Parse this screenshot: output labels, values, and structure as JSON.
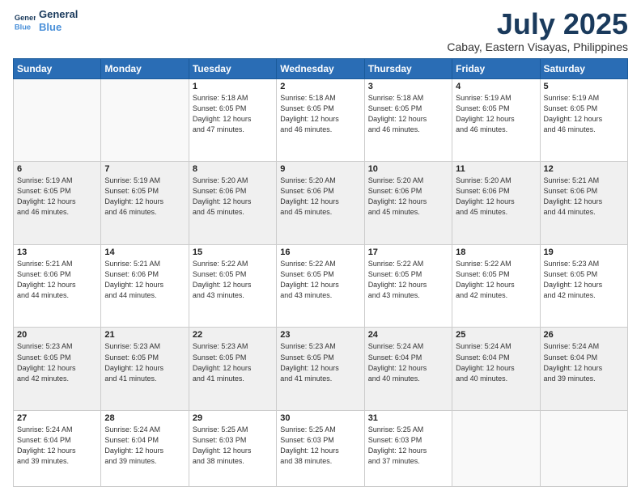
{
  "header": {
    "logo_line1": "General",
    "logo_line2": "Blue",
    "title": "July 2025",
    "subtitle": "Cabay, Eastern Visayas, Philippines"
  },
  "days_of_week": [
    "Sunday",
    "Monday",
    "Tuesday",
    "Wednesday",
    "Thursday",
    "Friday",
    "Saturday"
  ],
  "weeks": [
    [
      {
        "day": "",
        "info": ""
      },
      {
        "day": "",
        "info": ""
      },
      {
        "day": "1",
        "info": "Sunrise: 5:18 AM\nSunset: 6:05 PM\nDaylight: 12 hours\nand 47 minutes."
      },
      {
        "day": "2",
        "info": "Sunrise: 5:18 AM\nSunset: 6:05 PM\nDaylight: 12 hours\nand 46 minutes."
      },
      {
        "day": "3",
        "info": "Sunrise: 5:18 AM\nSunset: 6:05 PM\nDaylight: 12 hours\nand 46 minutes."
      },
      {
        "day": "4",
        "info": "Sunrise: 5:19 AM\nSunset: 6:05 PM\nDaylight: 12 hours\nand 46 minutes."
      },
      {
        "day": "5",
        "info": "Sunrise: 5:19 AM\nSunset: 6:05 PM\nDaylight: 12 hours\nand 46 minutes."
      }
    ],
    [
      {
        "day": "6",
        "info": "Sunrise: 5:19 AM\nSunset: 6:05 PM\nDaylight: 12 hours\nand 46 minutes."
      },
      {
        "day": "7",
        "info": "Sunrise: 5:19 AM\nSunset: 6:05 PM\nDaylight: 12 hours\nand 46 minutes."
      },
      {
        "day": "8",
        "info": "Sunrise: 5:20 AM\nSunset: 6:06 PM\nDaylight: 12 hours\nand 45 minutes."
      },
      {
        "day": "9",
        "info": "Sunrise: 5:20 AM\nSunset: 6:06 PM\nDaylight: 12 hours\nand 45 minutes."
      },
      {
        "day": "10",
        "info": "Sunrise: 5:20 AM\nSunset: 6:06 PM\nDaylight: 12 hours\nand 45 minutes."
      },
      {
        "day": "11",
        "info": "Sunrise: 5:20 AM\nSunset: 6:06 PM\nDaylight: 12 hours\nand 45 minutes."
      },
      {
        "day": "12",
        "info": "Sunrise: 5:21 AM\nSunset: 6:06 PM\nDaylight: 12 hours\nand 44 minutes."
      }
    ],
    [
      {
        "day": "13",
        "info": "Sunrise: 5:21 AM\nSunset: 6:06 PM\nDaylight: 12 hours\nand 44 minutes."
      },
      {
        "day": "14",
        "info": "Sunrise: 5:21 AM\nSunset: 6:06 PM\nDaylight: 12 hours\nand 44 minutes."
      },
      {
        "day": "15",
        "info": "Sunrise: 5:22 AM\nSunset: 6:05 PM\nDaylight: 12 hours\nand 43 minutes."
      },
      {
        "day": "16",
        "info": "Sunrise: 5:22 AM\nSunset: 6:05 PM\nDaylight: 12 hours\nand 43 minutes."
      },
      {
        "day": "17",
        "info": "Sunrise: 5:22 AM\nSunset: 6:05 PM\nDaylight: 12 hours\nand 43 minutes."
      },
      {
        "day": "18",
        "info": "Sunrise: 5:22 AM\nSunset: 6:05 PM\nDaylight: 12 hours\nand 42 minutes."
      },
      {
        "day": "19",
        "info": "Sunrise: 5:23 AM\nSunset: 6:05 PM\nDaylight: 12 hours\nand 42 minutes."
      }
    ],
    [
      {
        "day": "20",
        "info": "Sunrise: 5:23 AM\nSunset: 6:05 PM\nDaylight: 12 hours\nand 42 minutes."
      },
      {
        "day": "21",
        "info": "Sunrise: 5:23 AM\nSunset: 6:05 PM\nDaylight: 12 hours\nand 41 minutes."
      },
      {
        "day": "22",
        "info": "Sunrise: 5:23 AM\nSunset: 6:05 PM\nDaylight: 12 hours\nand 41 minutes."
      },
      {
        "day": "23",
        "info": "Sunrise: 5:23 AM\nSunset: 6:05 PM\nDaylight: 12 hours\nand 41 minutes."
      },
      {
        "day": "24",
        "info": "Sunrise: 5:24 AM\nSunset: 6:04 PM\nDaylight: 12 hours\nand 40 minutes."
      },
      {
        "day": "25",
        "info": "Sunrise: 5:24 AM\nSunset: 6:04 PM\nDaylight: 12 hours\nand 40 minutes."
      },
      {
        "day": "26",
        "info": "Sunrise: 5:24 AM\nSunset: 6:04 PM\nDaylight: 12 hours\nand 39 minutes."
      }
    ],
    [
      {
        "day": "27",
        "info": "Sunrise: 5:24 AM\nSunset: 6:04 PM\nDaylight: 12 hours\nand 39 minutes."
      },
      {
        "day": "28",
        "info": "Sunrise: 5:24 AM\nSunset: 6:04 PM\nDaylight: 12 hours\nand 39 minutes."
      },
      {
        "day": "29",
        "info": "Sunrise: 5:25 AM\nSunset: 6:03 PM\nDaylight: 12 hours\nand 38 minutes."
      },
      {
        "day": "30",
        "info": "Sunrise: 5:25 AM\nSunset: 6:03 PM\nDaylight: 12 hours\nand 38 minutes."
      },
      {
        "day": "31",
        "info": "Sunrise: 5:25 AM\nSunset: 6:03 PM\nDaylight: 12 hours\nand 37 minutes."
      },
      {
        "day": "",
        "info": ""
      },
      {
        "day": "",
        "info": ""
      }
    ]
  ]
}
